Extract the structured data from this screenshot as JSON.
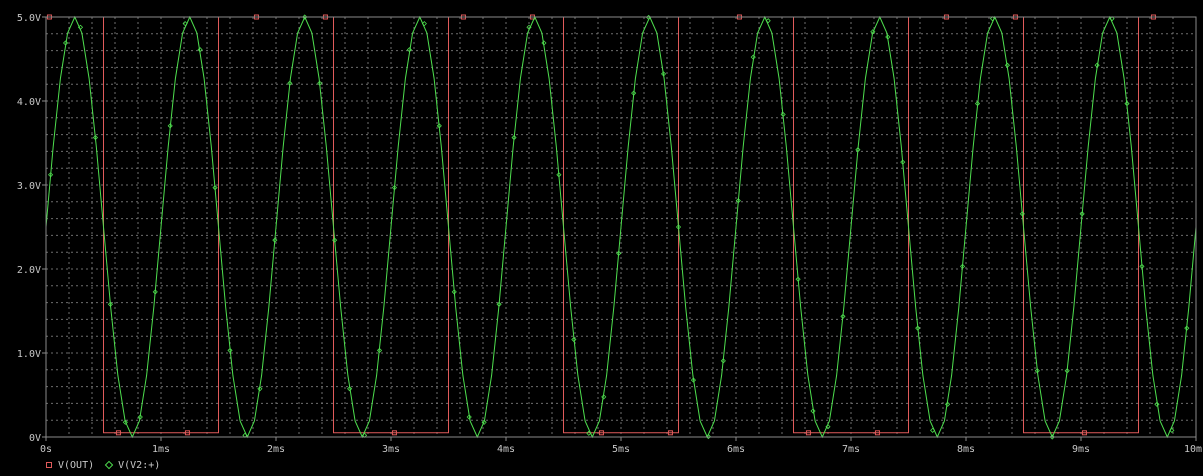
{
  "chart_data": {
    "type": "line",
    "title": "",
    "xlabel": "",
    "ylabel": "",
    "x_unit": "ms",
    "xlim": [
      0,
      10
    ],
    "ylim": [
      0,
      5
    ],
    "x_ticks": [
      "0s",
      "1ms",
      "2ms",
      "3ms",
      "4ms",
      "5ms",
      "6ms",
      "7ms",
      "8ms",
      "9ms",
      "10ms"
    ],
    "y_ticks": [
      "0V",
      "1.0V",
      "2.0V",
      "3.0V",
      "4.0V",
      "5.0V"
    ],
    "grid": true,
    "legend_position": "bottom-left",
    "series": [
      {
        "name": "V(OUT)",
        "color": "#e05a5a",
        "marker": "square",
        "x": [
          0,
          0.5,
          0.5,
          1.5,
          1.5,
          2.5,
          2.5,
          3.5,
          3.5,
          4.5,
          4.5,
          5.5,
          5.5,
          6.5,
          6.5,
          7.5,
          7.5,
          8.5,
          8.5,
          9.5,
          9.5,
          10
        ],
        "y": [
          5,
          5,
          0.05,
          0.05,
          5,
          5,
          0.05,
          0.05,
          5,
          5,
          0.05,
          0.05,
          5,
          5,
          0.05,
          0.05,
          5,
          5,
          0.05,
          0.05,
          5,
          5
        ]
      },
      {
        "name": "V(V2:+)",
        "color": "#4ede4e",
        "marker": "diamond",
        "amplitude": 2.5,
        "offset": 2.5,
        "frequency_khz": 1,
        "points_per_ms": 16
      }
    ]
  }
}
